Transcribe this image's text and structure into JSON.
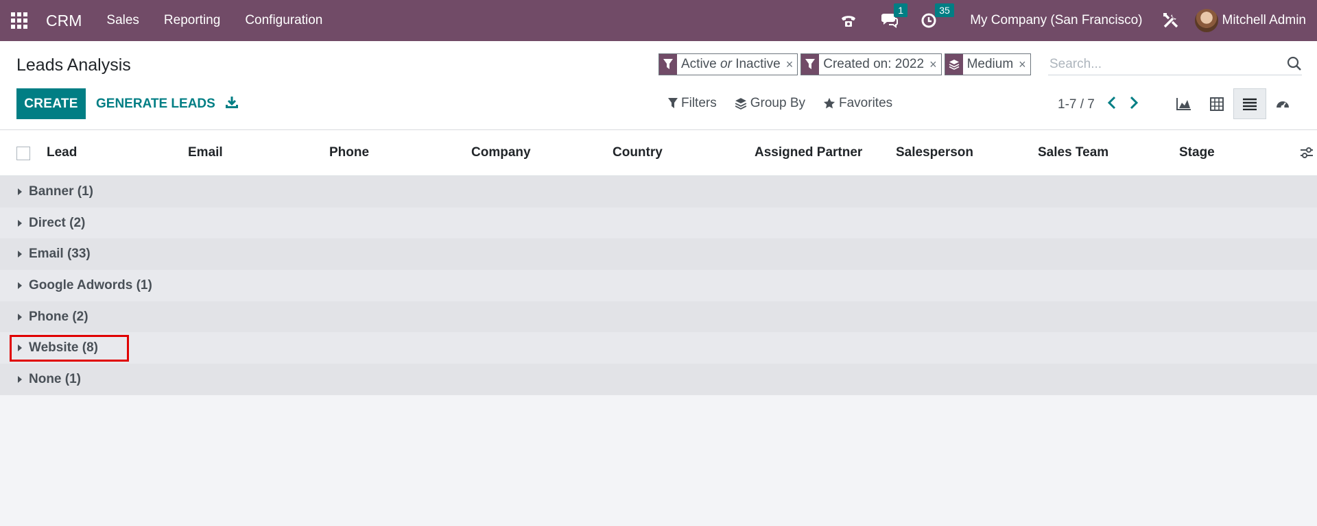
{
  "navbar": {
    "app_name": "CRM",
    "menu": [
      "Sales",
      "Reporting",
      "Configuration"
    ],
    "messages_badge": "1",
    "activities_badge": "35",
    "company": "My Company (San Francisco)",
    "user": "Mitchell Admin"
  },
  "control": {
    "title": "Leads Analysis",
    "facets": [
      {
        "pre": "Active ",
        "em": "or",
        "post": " Inactive",
        "icon": "filter-icon"
      },
      {
        "pre": "Created on: 2022",
        "em": "",
        "post": "",
        "icon": "filter-icon"
      },
      {
        "pre": "Medium",
        "em": "",
        "post": "",
        "icon": "group-by-icon"
      }
    ],
    "search_placeholder": "Search...",
    "create_label": "CREATE",
    "generate_label": "GENERATE LEADS",
    "filters_label": "Filters",
    "groupby_label": "Group By",
    "favorites_label": "Favorites",
    "pager": "1-7 / 7"
  },
  "table": {
    "columns": [
      "Lead",
      "Email",
      "Phone",
      "Company",
      "Country",
      "Assigned Partner",
      "Salesperson",
      "Sales Team",
      "Stage"
    ],
    "groups": [
      {
        "label": "Banner (1)"
      },
      {
        "label": "Direct (2)"
      },
      {
        "label": "Email (33)"
      },
      {
        "label": "Google Adwords (1)"
      },
      {
        "label": "Phone (2)"
      },
      {
        "label": "Website (8)"
      },
      {
        "label": "None (1)"
      }
    ]
  },
  "colors": {
    "navbar": "#714b67",
    "primary": "#017e84",
    "highlight": "#e00000"
  }
}
